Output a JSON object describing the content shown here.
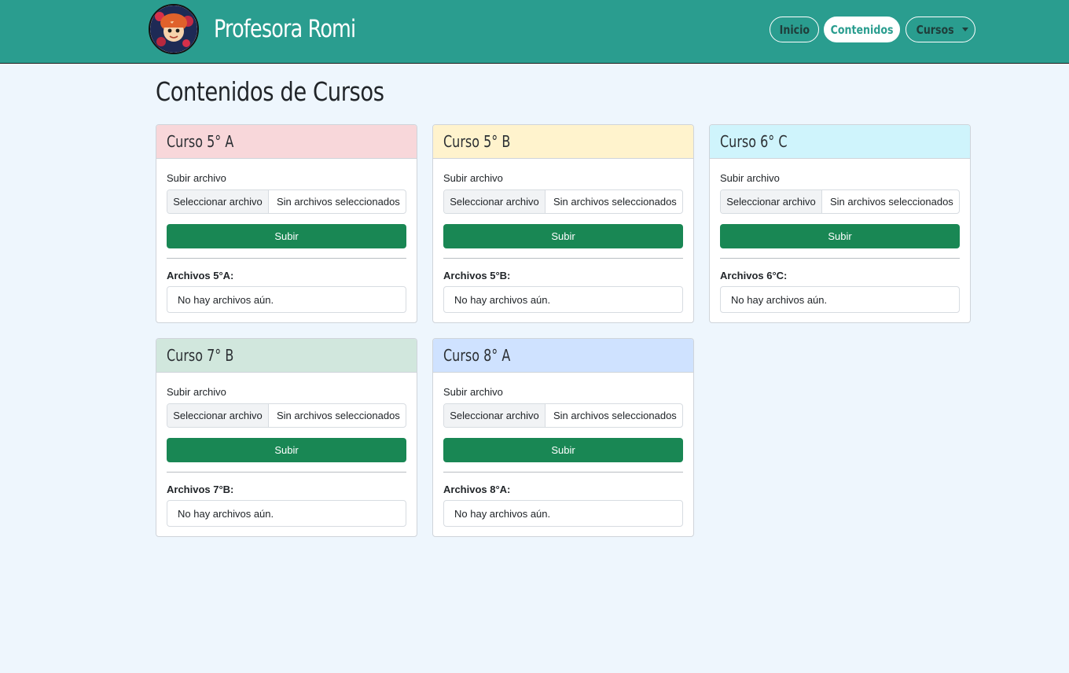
{
  "header": {
    "brand_name": "Profesora Romi",
    "nav": [
      {
        "label": "Inicio",
        "active": false
      },
      {
        "label": "Contenidos",
        "active": true
      },
      {
        "label": "Cursos",
        "active": false,
        "dropdown": true
      }
    ],
    "bg_color": "#2a9d8f"
  },
  "main": {
    "title": "Contenidos de Cursos",
    "courses": [
      {
        "title": "Curso 5° A",
        "header_color": "#f8d7da",
        "upload_label": "Subir archivo",
        "file_button": "Seleccionar archivo",
        "file_text": "Sin archivos seleccionados",
        "submit_label": "Subir",
        "files_label": "Archivos 5°A:",
        "empty_text": "No hay archivos aún."
      },
      {
        "title": "Curso 5° B",
        "header_color": "#fff3cd",
        "upload_label": "Subir archivo",
        "file_button": "Seleccionar archivo",
        "file_text": "Sin archivos seleccionados",
        "submit_label": "Subir",
        "files_label": "Archivos 5°B:",
        "empty_text": "No hay archivos aún."
      },
      {
        "title": "Curso 6° C",
        "header_color": "#cff4fc",
        "upload_label": "Subir archivo",
        "file_button": "Seleccionar archivo",
        "file_text": "Sin archivos seleccionados",
        "submit_label": "Subir",
        "files_label": "Archivos 6°C:",
        "empty_text": "No hay archivos aún."
      },
      {
        "title": "Curso 7° B",
        "header_color": "#d1e7dd",
        "upload_label": "Subir archivo",
        "file_button": "Seleccionar archivo",
        "file_text": "Sin archivos seleccionados",
        "submit_label": "Subir",
        "files_label": "Archivos 7°B:",
        "empty_text": "No hay archivos aún."
      },
      {
        "title": "Curso 8° A",
        "header_color": "#cfe2ff",
        "upload_label": "Subir archivo",
        "file_button": "Seleccionar archivo",
        "file_text": "Sin archivos seleccionados",
        "submit_label": "Subir",
        "files_label": "Archivos 8°A:",
        "empty_text": "No hay archivos aún."
      }
    ],
    "button_color": "#198754",
    "page_bg": "#eef6fd"
  }
}
